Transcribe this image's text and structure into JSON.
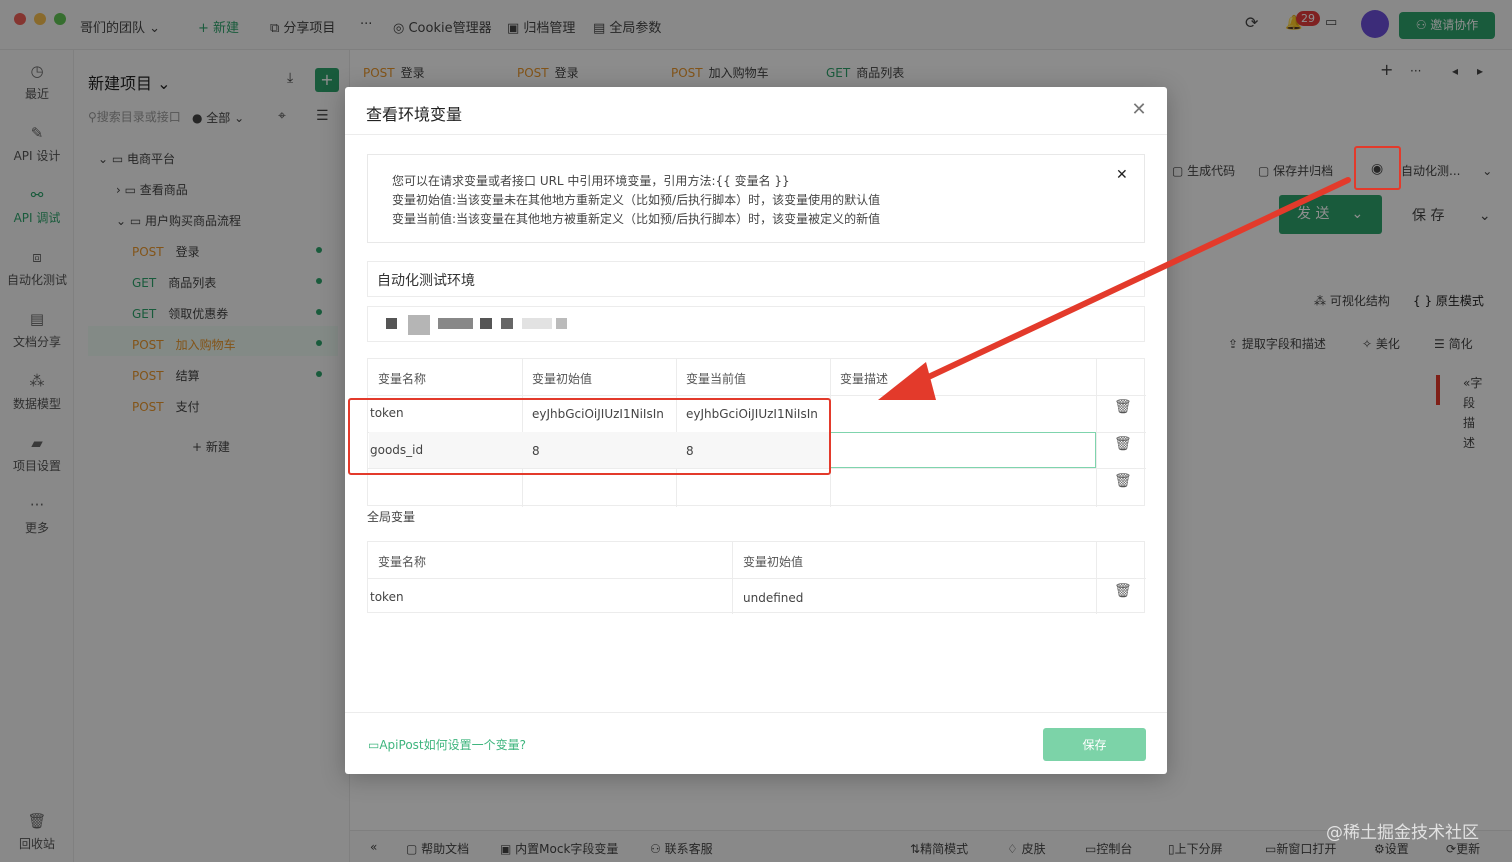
{
  "titlebar": {
    "team": "哥们的团队",
    "new": "+ 新建",
    "share": "分享项目",
    "more": "···",
    "cookie": "Cookie管理器",
    "archive": "归档管理",
    "global_params": "全局参数",
    "notifications": "29",
    "invite": "邀请协作"
  },
  "nav": [
    {
      "label": "最近",
      "icon": "clock-icon"
    },
    {
      "label": "API 设计",
      "icon": "edit-icon"
    },
    {
      "label": "API 调试",
      "icon": "link-icon"
    },
    {
      "label": "自动化测试",
      "icon": "flow-icon"
    },
    {
      "label": "文档分享",
      "icon": "doc-icon"
    },
    {
      "label": "数据模型",
      "icon": "model-icon"
    },
    {
      "label": "项目设置",
      "icon": "folder-gear-icon"
    },
    {
      "label": "更多",
      "icon": "more-icon"
    },
    {
      "label": "回收站",
      "icon": "trash-icon"
    }
  ],
  "tree": {
    "project": "新建项目",
    "search_placeholder": "搜索目录或接口",
    "filter": "全部",
    "nodes": {
      "root": "电商平台",
      "browse": "查看商品",
      "flow": "用户购买商品流程",
      "login": {
        "method": "POST",
        "name": "登录"
      },
      "list": {
        "method": "GET",
        "name": "商品列表"
      },
      "coupon": {
        "method": "GET",
        "name": "领取优惠券"
      },
      "cart": {
        "method": "POST",
        "name": "加入购物车"
      },
      "checkout": {
        "method": "POST",
        "name": "结算"
      },
      "pay": {
        "method": "POST",
        "name": "支付"
      }
    },
    "new": "+ 新建"
  },
  "tabs": [
    {
      "method": "POST",
      "name": "登录"
    },
    {
      "method": "POST",
      "name": "登录"
    },
    {
      "method": "POST",
      "name": "加入购物车"
    },
    {
      "method": "GET",
      "name": "商品列表"
    }
  ],
  "main": {
    "gen_code": "生成代码",
    "save_archive": "保存并归档",
    "env_select": "自动化测...",
    "send": "发 送",
    "save": "保 存",
    "visual": "可视化结构",
    "raw": "{ } 原生模式",
    "extract": "提取字段和描述",
    "beautify": "美化",
    "simplify": "简化",
    "side_panel": "字段描述"
  },
  "bottombar": {
    "help": "帮助文档",
    "mock": "内置Mock字段变量",
    "support": "联系客服",
    "lite": "精简模式",
    "skin": "皮肤",
    "console": "控制台",
    "split": "上下分屏",
    "new_window": "新窗口打开",
    "settings": "设置",
    "update": "更新"
  },
  "modal": {
    "title": "查看环境变量",
    "tip": [
      "您可以在请求变量或者接口 URL 中引用环境变量，引用方法:{{ 变量名 }}",
      "变量初始值:当该变量未在其他地方重新定义（比如预/后执行脚本）时，该变量使用的默认值",
      "变量当前值:当该变量在其他地方被重新定义（比如预/后执行脚本）时，该变量被定义的新值"
    ],
    "env_name": "自动化测试环境",
    "env_headers": [
      "变量名称",
      "变量初始值",
      "变量当前值",
      "变量描述"
    ],
    "env_rows": [
      {
        "name": "token",
        "initial": "eyJhbGciOiJIUzI1NiIsIn",
        "current": "eyJhbGciOiJIUzI1NiIsIn",
        "desc": ""
      },
      {
        "name": "goods_id",
        "initial": "8",
        "current": "8",
        "desc": ""
      }
    ],
    "global_label": "全局变量",
    "global_headers": [
      "变量名称",
      "变量初始值"
    ],
    "global_rows": [
      {
        "name": "token",
        "initial": "undefined"
      }
    ],
    "help_link": "ApiPost如何设置一个变量?",
    "save": "保存"
  },
  "watermark": "@稀土掘金技术社区",
  "colors": {
    "accent": "#2ea36b",
    "post": "#e9962c",
    "annotation": "#e33a2b"
  }
}
